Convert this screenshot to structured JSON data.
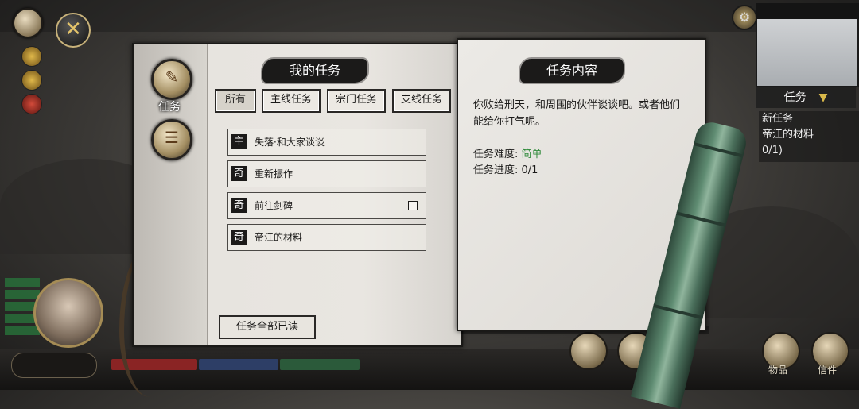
{
  "left_panel": {
    "title": "我的任务",
    "side_tab_label": "任务",
    "filters": [
      "所有",
      "主线任务",
      "宗门任务",
      "支线任务"
    ],
    "tasks": [
      {
        "tag": "主",
        "name": "失落·和大家谈谈",
        "has_checkbox": false
      },
      {
        "tag": "奇",
        "name": "重新振作",
        "has_checkbox": false
      },
      {
        "tag": "奇",
        "name": "前往剑碑",
        "has_checkbox": true
      },
      {
        "tag": "奇",
        "name": "帝江的材料",
        "has_checkbox": false
      }
    ],
    "read_all_label": "任务全部已读"
  },
  "right_panel": {
    "title": "任务内容",
    "description": "你败给刑天，和周围的伙伴谈谈吧。或者他们能给你打气呢。",
    "difficulty_label": "任务难度:",
    "difficulty_value": "简单",
    "progress_label": "任务进度:",
    "progress_value": "0/1"
  },
  "hud": {
    "task_tab": "任务",
    "task_preview": [
      "新任务",
      "帝江的材料",
      "0/1)"
    ],
    "bottom_labels": [
      "物品",
      "信件"
    ]
  },
  "colors": {
    "easy": "#2f8a3a",
    "ink": "#1b1a19",
    "paper": "#e9e6e1"
  }
}
